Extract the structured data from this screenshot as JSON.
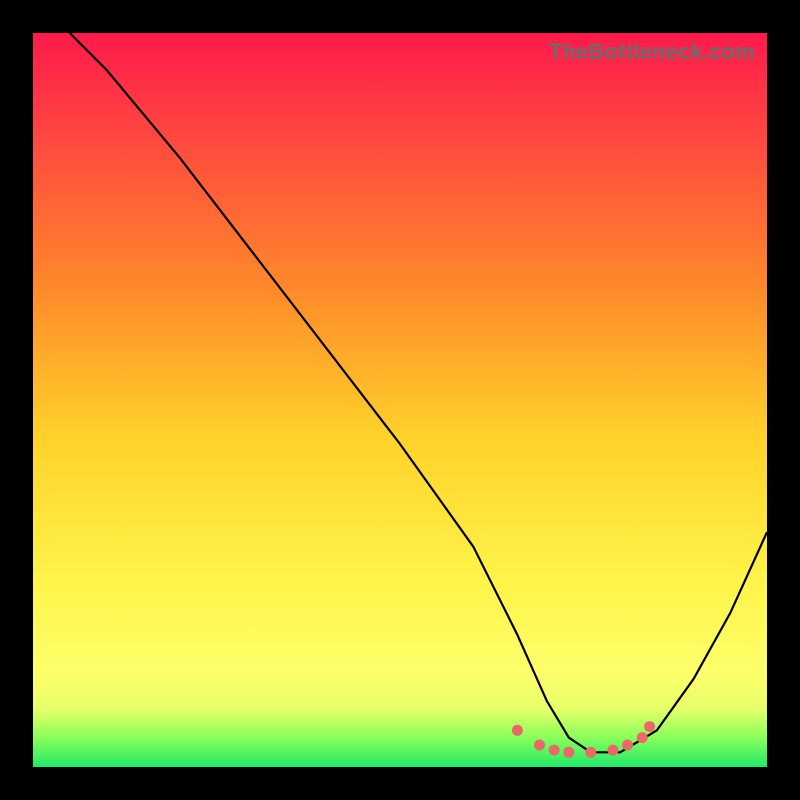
{
  "attribution": "TheBottleneck.com",
  "colors": {
    "background": "#000000",
    "gradient_top": "#ff1a4b",
    "gradient_bottom": "#22e86a",
    "curve": "#000000",
    "dots": "#e86a66"
  },
  "chart_data": {
    "type": "line",
    "title": "",
    "xlabel": "",
    "ylabel": "",
    "xlim": [
      0,
      100
    ],
    "ylim": [
      0,
      100
    ],
    "grid": false,
    "legend": false,
    "annotations": [],
    "series": [
      {
        "name": "bottleneck-curve",
        "x": [
          5,
          10,
          20,
          30,
          40,
          50,
          60,
          66,
          70,
          73,
          76,
          80,
          85,
          90,
          95,
          100
        ],
        "values": [
          100,
          95,
          83,
          70,
          57,
          44,
          30,
          18,
          9,
          4,
          2,
          2,
          5,
          12,
          21,
          32
        ]
      }
    ],
    "markers": {
      "name": "highlight-dots",
      "x": [
        66,
        69,
        71,
        73,
        76,
        79,
        81,
        83,
        84
      ],
      "values": [
        5.0,
        3.0,
        2.3,
        2.0,
        2.0,
        2.3,
        3.0,
        4.0,
        5.5
      ]
    }
  }
}
